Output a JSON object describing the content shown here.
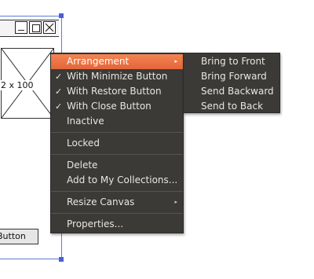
{
  "mockup": {
    "image_label": "2 x 100",
    "button_label": "Button",
    "selection_color": "#4a5fd6"
  },
  "context_menu": {
    "items": [
      {
        "label": "Arrangement",
        "checked": false,
        "submenu": true,
        "highlighted": true
      },
      {
        "label": "With Minimize Button",
        "checked": true
      },
      {
        "label": "With Restore Button",
        "checked": true
      },
      {
        "label": "With Close Button",
        "checked": true
      },
      {
        "label": "Inactive",
        "checked": false
      },
      {
        "label": "Locked",
        "checked": false
      },
      {
        "label": "Delete",
        "checked": false
      },
      {
        "label": "Add to My Collections...",
        "checked": false
      },
      {
        "label": "Resize Canvas",
        "checked": false,
        "submenu": true
      },
      {
        "label": "Properties...",
        "checked": false
      }
    ],
    "check_glyph": "✓",
    "arrow_glyph": "▸",
    "highlight_color": "#f07746",
    "background_color": "#3b3a37"
  },
  "arrangement_submenu": {
    "items": [
      {
        "label": "Bring to Front"
      },
      {
        "label": "Bring Forward"
      },
      {
        "label": "Send Backward"
      },
      {
        "label": "Send to Back"
      }
    ]
  }
}
